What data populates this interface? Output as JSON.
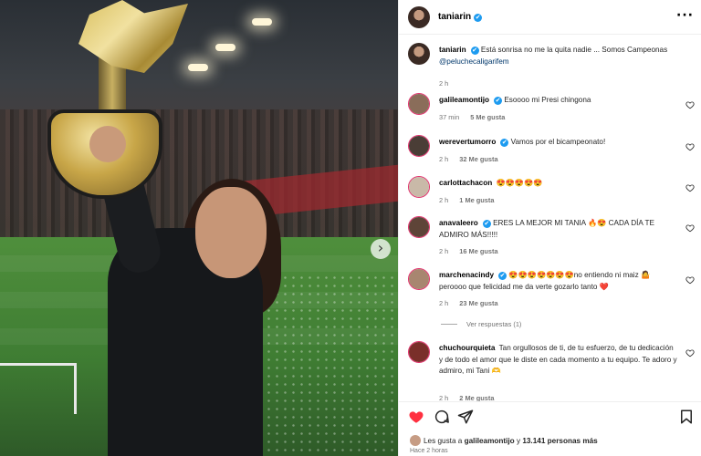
{
  "header": {
    "username": "taniarin",
    "verified_mark": "✔",
    "more_icon": "···"
  },
  "caption": {
    "username": "taniarin",
    "text": "Está sonrisa no me la quita nadie ... Somos Campeonas",
    "mention": "@peluchecaligarifem",
    "time": "2 h"
  },
  "comments": [
    {
      "username": "galileamontijo",
      "verified": true,
      "text": "Esoooo mi Presi chingona",
      "time": "37 min",
      "likes": "5 Me gusta",
      "avatar_color": "#8a6d5a"
    },
    {
      "username": "werevertumorro",
      "verified": true,
      "text": "Vamos por el bicampeonato!",
      "time": "2 h",
      "likes": "32 Me gusta",
      "avatar_color": "#4a3d36"
    },
    {
      "username": "carlottachacon",
      "verified": false,
      "text": "😍😍😍😍😍",
      "time": "2 h",
      "likes": "1 Me gusta",
      "avatar_color": "#c9b9a8"
    },
    {
      "username": "anavaleero",
      "verified": true,
      "text": "ERES LA MEJOR MI TANIA 🔥😍 CADA DÍA TE ADMIRO MÁS!!!!!",
      "time": "2 h",
      "likes": "16 Me gusta",
      "avatar_color": "#5e4438"
    },
    {
      "username": "marchenacindy",
      "verified": true,
      "text": "😍😍😍😍😍😍😍no entiendo ni maiz 🤷 peroooo que felicidad me da verte gozarlo tanto ❤️",
      "time": "2 h",
      "likes": "23 Me gusta",
      "avatar_color": "#a88670"
    },
    {
      "username": "chuchourquieta",
      "verified": false,
      "text": "Tan orgullosos de ti, de tu esfuerzo, de tu dedicación y de todo el amor que le diste en cada momento a tu equipo. Te adoro y admiro, mi Tani 🫶",
      "time": "2 h",
      "likes": "2 Me gusta",
      "avatar_color": "#7a2f2a"
    }
  ],
  "view_replies": "Ver respuestas (1)",
  "likes_summary": {
    "prefix": "Les gusta a",
    "user": "galileamontijo",
    "middle": "y",
    "count": "13.141 personas más"
  },
  "post_time": "Hace 2 horas",
  "colors": {
    "like_red": "#ff3040",
    "verified_blue": "#1d9bf0",
    "story_ring": "#e1306c",
    "mention_blue": "#00376b"
  },
  "icons": {
    "like": "heart-icon",
    "comment": "comment-icon",
    "share": "send-icon",
    "save": "bookmark-icon",
    "next": "chevron-right-icon"
  }
}
